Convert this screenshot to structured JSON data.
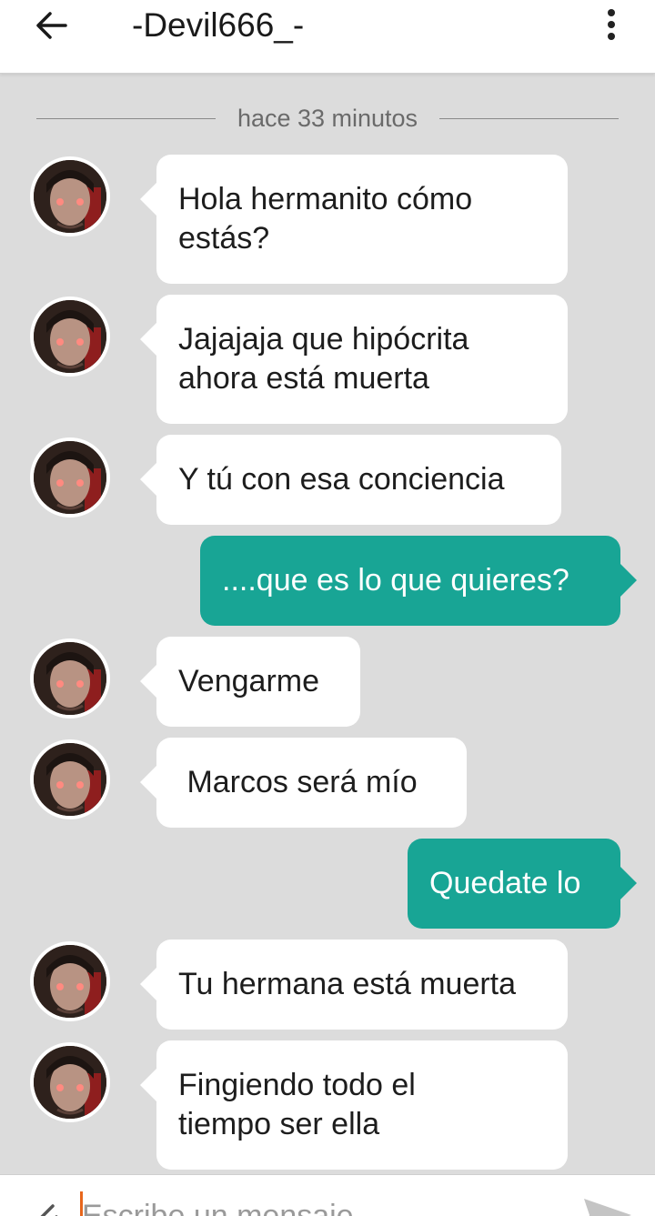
{
  "header": {
    "title": "-Devil666_-",
    "back_icon": "arrow-left-icon",
    "more_icon": "more-vertical-icon"
  },
  "timestamp_divider": "hace 33 minutos",
  "messages": [
    {
      "direction": "in",
      "lines": [
        "Hola hermanito cómo",
        "estás?"
      ]
    },
    {
      "direction": "in",
      "lines": [
        "Jajajaja que hipócrita",
        "ahora está muerta"
      ]
    },
    {
      "direction": "in",
      "lines": [
        "Y tú con esa conciencia"
      ]
    },
    {
      "direction": "out",
      "lines": [
        "....que es lo que quieres?"
      ]
    },
    {
      "direction": "in",
      "lines": [
        "Vengarme"
      ]
    },
    {
      "direction": "in",
      "lines": [
        " Marcos será mío"
      ]
    },
    {
      "direction": "out",
      "lines": [
        "Quedate lo"
      ]
    },
    {
      "direction": "in",
      "lines": [
        "Tu hermana está muerta"
      ]
    },
    {
      "direction": "in",
      "lines": [
        "Fingiendo todo el",
        "tiempo ser ella"
      ]
    }
  ],
  "composer": {
    "placeholder": "Escribe un mensaje",
    "value": "",
    "attach_icon": "paperclip-icon",
    "send_icon": "send-icon"
  },
  "colors": {
    "background": "#dcdcdc",
    "incoming_bubble": "#ffffff",
    "outgoing_bubble": "#18a595",
    "cursor": "#e8661c"
  }
}
